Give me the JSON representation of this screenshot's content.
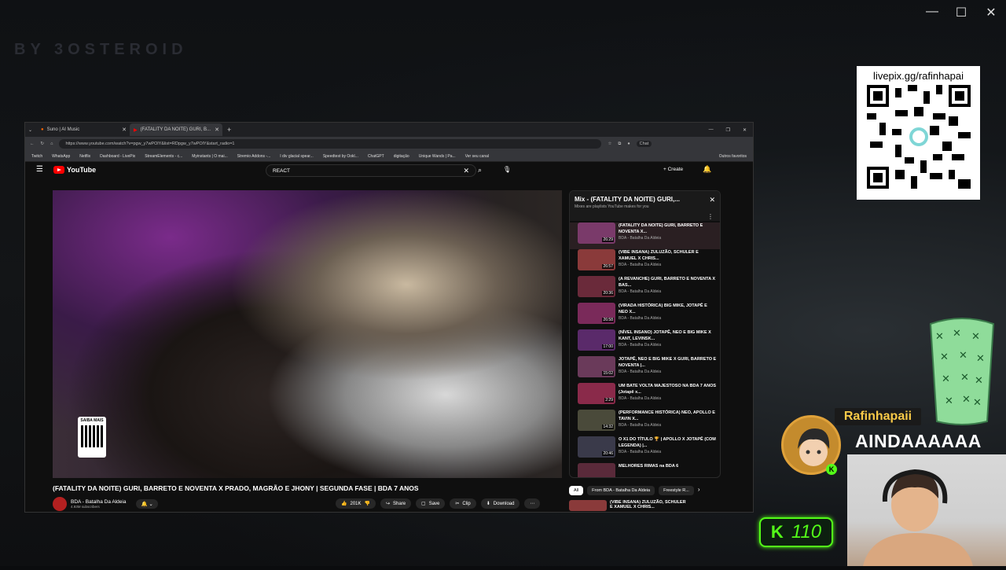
{
  "desktop": {
    "bg_title": "BY 3OSTEROID",
    "accent": "#53fc18"
  },
  "browser": {
    "tabs": [
      {
        "label": "Suno | AI Music"
      },
      {
        "label": "(FATALITY DA NOITE) GURI, B..."
      }
    ],
    "url": "https://www.youtube.com/watch?v=pgw_y7wPOlY&list=RDpgw_y7wPOlY&start_radio=1",
    "bookmarks": [
      "Twitch",
      "WhatsApp",
      "Netflix",
      "Dashboard - LivePix",
      "StreamElements - c...",
      "Myinstants | O mai...",
      "Stremio Addons -...",
      "I div glacial spear...",
      "Speedtest by Ookl...",
      "ChatGPT",
      "digitação",
      "Unique Wands | Pa...",
      "Ver seu canal",
      "Outros favoritos"
    ]
  },
  "youtube": {
    "logo": "YouTube",
    "search_value": "REACT",
    "create_label": "Create",
    "video_title": "(FATALITY DA NOITE) GURI, BARRETO E NOVENTA X PRADO, MAGRÃO E JHONY | SEGUNDA FASE | BDA 7 ANOS",
    "channel": "BDA - Batalha Da Aldeia",
    "subscribers": "4.93M subscribers",
    "likes": "201K",
    "share": "Share",
    "save": "Save",
    "clip": "Clip",
    "download": "Download",
    "qr_label": "SAIBA MAIS",
    "mix_title": "Mix - (FATALITY DA NOITE) GURI,...",
    "mix_sub": "Mixes are playlists YouTube makes for you",
    "playlist": [
      {
        "title": "(FATALITY DA NOITE) GURI, BARRETO E NOVENTA X...",
        "channel": "BDA - Batalha Da Aldeia",
        "dur": "26:29",
        "color": "#7a3a6a"
      },
      {
        "title": "(VIBE INSANA) ZULUZÃO, SCHULER E XAMUEL X CHRIS...",
        "channel": "BDA - Batalha Da Aldeia",
        "dur": "26:57",
        "color": "#8a3a3a"
      },
      {
        "title": "(A REVANCHE) GURI, BARRETO E NOVENTA X BAS...",
        "channel": "BDA - Batalha Da Aldeia",
        "dur": "20:36",
        "color": "#6a2a3a"
      },
      {
        "title": "(VIRADA HISTÓRICA) BIG MIKE, JOTAPÊ E NEO X...",
        "channel": "BDA - Batalha Da Aldeia",
        "dur": "26:58",
        "color": "#7a2a5a"
      },
      {
        "title": "(NÍVEL INSANO) JOTAPÊ, NEO E BIG MIKE X KANT, LEVINSK...",
        "channel": "BDA - Batalha Da Aldeia",
        "dur": "17:00",
        "color": "#5a2a6a"
      },
      {
        "title": "JOTAPÊ, NEO E BIG MIKE X GURI, BARRETO E NOVENTA |...",
        "channel": "BDA - Batalha Da Aldeia",
        "dur": "15:02",
        "color": "#6a3a5a"
      },
      {
        "title": "UM BATE VOLTA MAJESTOSO NA BDA 7 ANOS (Jotapê x...",
        "channel": "BDA - Batalha Da Aldeia",
        "dur": "2:29",
        "color": "#8a2a4a"
      },
      {
        "title": "(PERFORMANCE HISTÓRICA) NEO, APOLLO E TAVIN X...",
        "channel": "BDA - Batalha Da Aldeia",
        "dur": "14:32",
        "color": "#4a4a3a"
      },
      {
        "title": "O X1 DO TÍTULO 🏆 | APOLLO X JOTAPÊ (COM LEGENDA) |...",
        "channel": "BDA - Batalha Da Aldeia",
        "dur": "20:46",
        "color": "#3a3a4a"
      },
      {
        "title": "MELHORES RIMAS na BDA 6",
        "channel": "",
        "dur": "",
        "color": "#5a2a3a"
      }
    ],
    "chips": [
      "All",
      "From BDA - Batalha Da Aldeia",
      "Freestyle R..."
    ],
    "below_item": "(VIBE INSANA) ZULUZÃO, SCHULER E XAMUEL X CHRIS..."
  },
  "overlay": {
    "livepix": "livepix.gg/rafinhapai",
    "username": "Rafinhapaii",
    "shout": "AINDAAAAAA",
    "kick_count": "110"
  }
}
